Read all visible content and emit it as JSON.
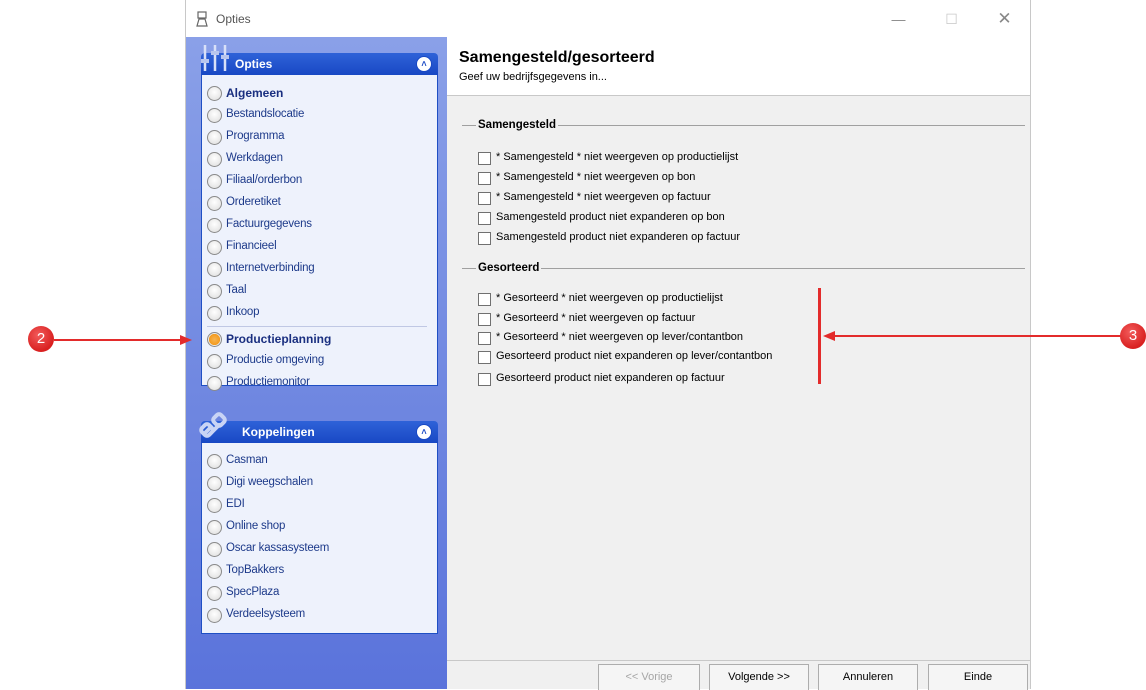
{
  "window": {
    "title": "Opties"
  },
  "sidebar": {
    "group1": {
      "title": "Opties",
      "items": [
        {
          "label": "Algemeen",
          "bold": true
        },
        {
          "label": "Bestandslocatie"
        },
        {
          "label": "Programma"
        },
        {
          "label": "Werkdagen"
        },
        {
          "label": "Filiaal/orderbon"
        },
        {
          "label": "Orderetiket"
        },
        {
          "label": "Factuurgegevens"
        },
        {
          "label": "Financieel"
        },
        {
          "label": "Internetverbinding"
        },
        {
          "label": "Taal"
        },
        {
          "label": "Inkoop"
        },
        {
          "label": "Productieplanning",
          "bold": true,
          "active": true
        },
        {
          "label": "Productie omgeving"
        },
        {
          "label": "Productiemonitor"
        }
      ]
    },
    "group2": {
      "title": "Koppelingen",
      "items": [
        {
          "label": "Casman"
        },
        {
          "label": "Digi weegschalen"
        },
        {
          "label": "EDI"
        },
        {
          "label": "Online shop"
        },
        {
          "label": "Oscar kassasysteem"
        },
        {
          "label": "TopBakkers"
        },
        {
          "label": "SpecPlaza"
        },
        {
          "label": "Verdeelsysteem"
        }
      ]
    }
  },
  "main": {
    "title": "Samengesteld/gesorteerd",
    "subtitle": "Geef uw bedrijfsgegevens in...",
    "sections": [
      {
        "title": "Samengesteld",
        "options": [
          {
            "label": "* Samengesteld * niet weergeven op productielijst",
            "checked": false
          },
          {
            "label": "* Samengesteld * niet weergeven op bon",
            "checked": false
          },
          {
            "label": "* Samengesteld * niet weergeven op factuur",
            "checked": false
          },
          {
            "label": "Samengesteld product niet expanderen op bon",
            "checked": false
          },
          {
            "label": "Samengesteld product niet expanderen op factuur",
            "checked": false
          }
        ]
      },
      {
        "title": "Gesorteerd",
        "options": [
          {
            "label": "* Gesorteerd * niet weergeven op productielijst",
            "checked": false
          },
          {
            "label": "* Gesorteerd * niet weergeven op factuur",
            "checked": false
          },
          {
            "label": "* Gesorteerd * niet weergeven op lever/contantbon",
            "checked": false
          },
          {
            "label": "Gesorteerd product niet expanderen op lever/contantbon",
            "checked": false
          },
          {
            "label": "Gesorteerd product niet expanderen op factuur",
            "checked": false
          }
        ]
      }
    ]
  },
  "footer": {
    "buttons": [
      {
        "label": "<< Vorige",
        "enabled": false
      },
      {
        "label": "Volgende >>",
        "enabled": true
      },
      {
        "label": "Annuleren",
        "enabled": true
      },
      {
        "label": "Einde",
        "enabled": true
      }
    ]
  },
  "annotations": {
    "left_marker": "2",
    "right_marker": "3",
    "color": "#d92020"
  },
  "colors": {
    "group_header": "#1848c4",
    "sidebar_bg": "#6d85e0",
    "active_radio": "#f39a1e"
  }
}
